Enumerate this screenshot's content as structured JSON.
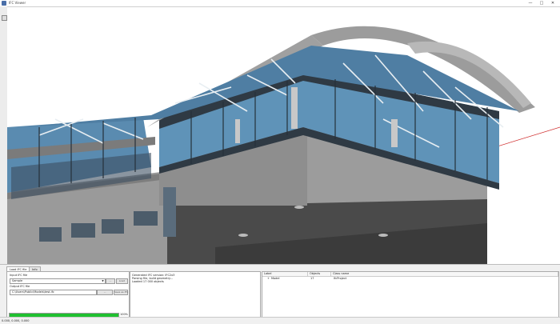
{
  "window": {
    "title": "IFC Viewer",
    "min_glyph": "—",
    "max_glyph": "□",
    "close_glyph": "✕"
  },
  "bottom": {
    "tabs": [
      "Load IFC file",
      "Info"
    ],
    "load": {
      "file_label": "Input IFC file",
      "file_value": "Sample",
      "browse_label": "...",
      "load_label": "Load",
      "export_label": "Output IFC file",
      "export_path": "C:\\Users\\Public\\Models\\test.ifc",
      "browse2_label": "...",
      "save_label": "Save as IFC"
    },
    "progress": {
      "value": 100,
      "text": "100%"
    },
    "log_lines": [
      "Generated IFC version: IFC2x3",
      "Parsing file, build geometry...",
      "Loaded 17 000 objects"
    ],
    "table": {
      "headers": [
        "Label",
        "Objects",
        "Class name"
      ],
      "rows": [
        {
          "label": "Model",
          "objects": "17",
          "class_name": "IfcProject"
        }
      ]
    }
  },
  "status": {
    "text": "0.000, 0.000, 0.000"
  },
  "colors": {
    "accent": "#20c030",
    "glass": "#5a8bb0",
    "building": "#8a8a8a",
    "axis": "#d03030"
  }
}
